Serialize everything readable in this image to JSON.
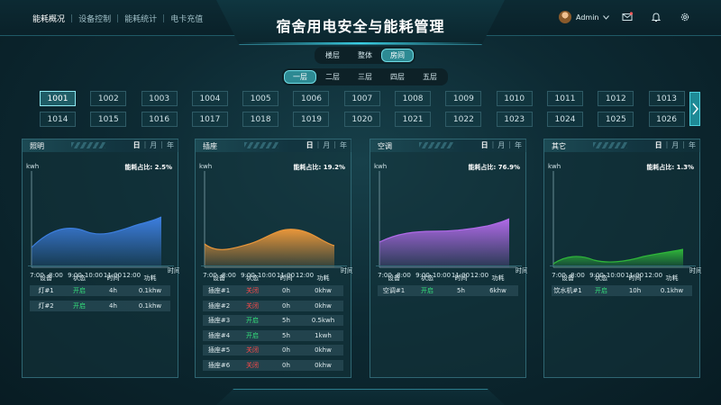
{
  "header": {
    "title": "宿舍用电安全与能耗管理",
    "nav": [
      "能耗概况",
      "设备控制",
      "能耗统计",
      "电卡充值"
    ],
    "nav_active": 0,
    "user": "Admin"
  },
  "view_tabs": {
    "items": [
      "楼层",
      "整体",
      "房间"
    ],
    "active": 2
  },
  "floor_tabs": {
    "items": [
      "一层",
      "二层",
      "三层",
      "四层",
      "五层"
    ],
    "active": 0
  },
  "rooms": {
    "items": [
      "1001",
      "1002",
      "1003",
      "1004",
      "1005",
      "1006",
      "1007",
      "1008",
      "1009",
      "1010",
      "1011",
      "1012",
      "1013",
      "1014",
      "1015",
      "1016",
      "1017",
      "1018",
      "1019",
      "1020",
      "1021",
      "1022",
      "1023",
      "1024",
      "1025",
      "1026"
    ],
    "active": 0
  },
  "periods": [
    "日",
    "月",
    "年"
  ],
  "table_headers": [
    "设备",
    "状态",
    "时间",
    "功耗"
  ],
  "panels": [
    {
      "title": "照明",
      "unit": "kwh",
      "ratio_label": "能耗占比: 2.5%",
      "x_labels": [
        "7:00",
        "8:00",
        "9:00",
        "10:00",
        "11:00",
        "12:00"
      ],
      "x_title": "时间",
      "color": "#3d7fe0",
      "rows": [
        {
          "device": "灯#1",
          "status": "开启",
          "on": true,
          "time": "4h",
          "power": "0.1khw"
        },
        {
          "device": "灯#2",
          "status": "开启",
          "on": true,
          "time": "4h",
          "power": "0.1khw"
        }
      ]
    },
    {
      "title": "插座",
      "unit": "kwh",
      "ratio_label": "能耗占比: 19.2%",
      "x_labels": [
        "7:00",
        "8:00",
        "9:00",
        "10:00",
        "11:00",
        "12:00"
      ],
      "x_title": "时间",
      "color": "#e8963a",
      "rows": [
        {
          "device": "插座#1",
          "status": "关闭",
          "on": false,
          "time": "0h",
          "power": "0khw"
        },
        {
          "device": "插座#2",
          "status": "关闭",
          "on": false,
          "time": "0h",
          "power": "0khw"
        },
        {
          "device": "插座#3",
          "status": "开启",
          "on": true,
          "time": "5h",
          "power": "0.5kwh"
        },
        {
          "device": "插座#4",
          "status": "开启",
          "on": true,
          "time": "5h",
          "power": "1kwh"
        },
        {
          "device": "插座#5",
          "status": "关闭",
          "on": false,
          "time": "0h",
          "power": "0khw"
        },
        {
          "device": "插座#6",
          "status": "关闭",
          "on": false,
          "time": "0h",
          "power": "0khw"
        }
      ]
    },
    {
      "title": "空调",
      "unit": "kwh",
      "ratio_label": "能耗占比: 76.9%",
      "x_labels": [
        "7:00",
        "8:00",
        "9:00",
        "10:00",
        "11:00",
        "12:00"
      ],
      "x_title": "时间",
      "color": "#b06ae8",
      "rows": [
        {
          "device": "空调#1",
          "status": "开启",
          "on": true,
          "time": "5h",
          "power": "6khw"
        }
      ]
    },
    {
      "title": "其它",
      "unit": "kwh",
      "ratio_label": "能耗占比: 1.3%",
      "x_labels": [
        "7:00",
        "8:00",
        "9:00",
        "10:00",
        "11:00",
        "12:00"
      ],
      "x_title": "时间",
      "color": "#2fb53a",
      "rows": [
        {
          "device": "饮水机#1",
          "status": "开启",
          "on": true,
          "time": "10h",
          "power": "0.1khw"
        }
      ]
    }
  ]
}
